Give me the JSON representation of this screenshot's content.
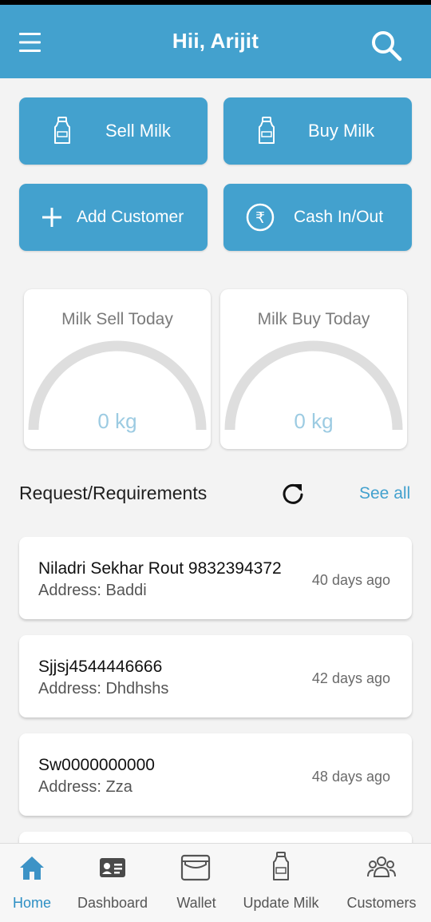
{
  "header": {
    "title": "Hii, Arijit",
    "menu_icon": "menu-icon",
    "search_icon": "search-icon"
  },
  "colors": {
    "primary": "#43a1ce",
    "gauge_track": "#dedede",
    "gauge_value": "#9ccbe2",
    "link": "#43a1ce"
  },
  "actions": {
    "sell_milk": {
      "label": "Sell Milk",
      "icon": "milk-bottle-icon"
    },
    "buy_milk": {
      "label": "Buy Milk",
      "icon": "milk-bottle-icon"
    },
    "add_customer": {
      "label": "Add Customer",
      "icon": "plus-icon"
    },
    "cash_in_out": {
      "label": "Cash In/Out",
      "icon": "rupee-icon"
    }
  },
  "gauges": {
    "sell": {
      "title": "Milk Sell Today",
      "value": "0 kg"
    },
    "buy": {
      "title": "Milk Buy Today",
      "value": "0 kg"
    }
  },
  "requests": {
    "title": "Request/Requirements",
    "see_all": "See all",
    "refresh_icon": "refresh-icon",
    "items": [
      {
        "name": "Niladri Sekhar Rout 9832394372",
        "address": "Address: Baddi",
        "ago": "40 days ago"
      },
      {
        "name": "Sjjsj4544446666",
        "address": "Address: Dhdhshs",
        "ago": "42 days ago"
      },
      {
        "name": "Sw0000000000",
        "address": "Address: Zza",
        "ago": "48 days ago"
      }
    ]
  },
  "nav": {
    "home": {
      "label": "Home",
      "icon": "home-icon",
      "active": true
    },
    "dashboard": {
      "label": "Dashboard",
      "icon": "id-card-icon"
    },
    "wallet": {
      "label": "Wallet",
      "icon": "wallet-icon"
    },
    "update_milk": {
      "label": "Update Milk",
      "icon": "milk-bottle-icon"
    },
    "customers": {
      "label": "Customers",
      "icon": "group-icon"
    }
  }
}
